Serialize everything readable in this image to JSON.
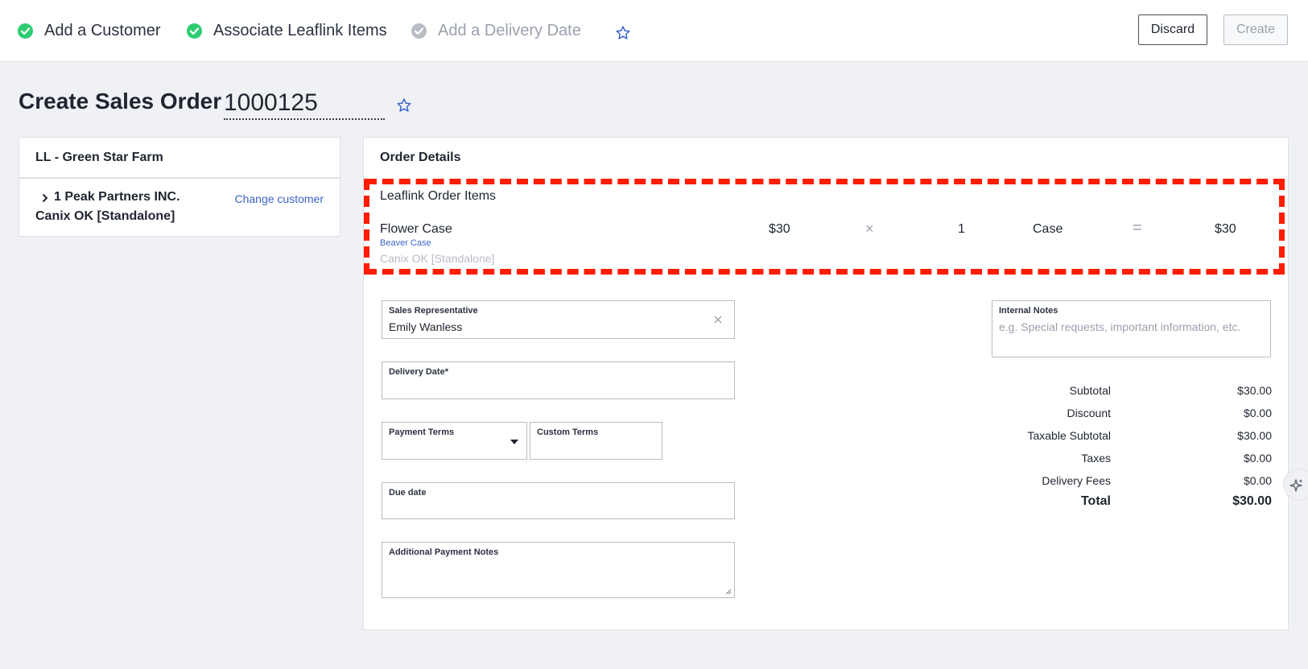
{
  "steps": [
    {
      "label": "Add a Customer",
      "status": "done"
    },
    {
      "label": "Associate Leaflink Items",
      "status": "done"
    },
    {
      "label": "Add a Delivery Date",
      "status": "pending"
    }
  ],
  "toolbar": {
    "discard_label": "Discard",
    "create_label": "Create"
  },
  "page": {
    "title": "Create Sales Order",
    "order_number": "1000125"
  },
  "customer_card": {
    "header": "LL - Green Star Farm",
    "customer_name": "1 Peak Partners INC.",
    "customer_sub": "Canix OK [Standalone]",
    "change_link": "Change customer"
  },
  "order_details": {
    "header": "Order Details",
    "items_title": "Leaflink Order Items",
    "items": [
      {
        "name": "Flower Case",
        "sub_link": "Beaver Case",
        "sub_text": "Canix OK [Standalone]",
        "price": "$30",
        "times": "×",
        "qty": "1",
        "unit": "Case",
        "equals": "=",
        "total": "$30"
      }
    ]
  },
  "form": {
    "sales_rep_label": "Sales Representative",
    "sales_rep_value": "Emily Wanless",
    "delivery_date_label": "Delivery Date*",
    "payment_terms_label": "Payment Terms",
    "custom_terms_label": "Custom Terms",
    "due_date_label": "Due date",
    "additional_notes_label": "Additional Payment Notes",
    "internal_notes_label": "Internal Notes",
    "internal_notes_placeholder": "e.g. Special requests, important information, etc."
  },
  "totals": [
    {
      "label": "Subtotal",
      "value": "$30.00"
    },
    {
      "label": "Discount",
      "value": "$0.00"
    },
    {
      "label": "Taxable Subtotal",
      "value": "$30.00"
    },
    {
      "label": "Taxes",
      "value": "$0.00"
    },
    {
      "label": "Delivery Fees",
      "value": "$0.00"
    }
  ],
  "grand_total": {
    "label": "Total",
    "value": "$30.00"
  },
  "colors": {
    "accent": "#3d63c9",
    "success": "#2ecc71",
    "highlight": "#ff1c00"
  },
  "icons": [
    "check-circle-icon",
    "star-outline-icon",
    "chevron-right-icon",
    "close-icon",
    "caret-down-icon",
    "sparkle-icon"
  ]
}
